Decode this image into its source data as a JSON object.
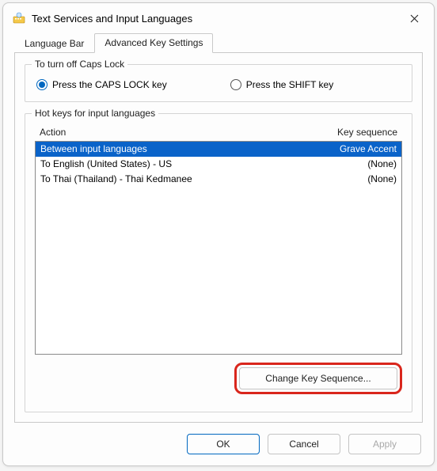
{
  "window": {
    "title": "Text Services and Input Languages"
  },
  "tabs": {
    "language_bar": "Language Bar",
    "advanced_key": "Advanced Key Settings"
  },
  "capslock": {
    "legend": "To turn off Caps Lock",
    "opt_capslock": "Press the CAPS LOCK key",
    "opt_shift": "Press the SHIFT key"
  },
  "hotkeys": {
    "legend": "Hot keys for input languages",
    "col_action": "Action",
    "col_seq": "Key sequence",
    "rows": [
      {
        "action": "Between input languages",
        "seq": "Grave Accent",
        "selected": true
      },
      {
        "action": "To English (United States) - US",
        "seq": "(None)",
        "selected": false
      },
      {
        "action": "To Thai (Thailand) - Thai Kedmanee",
        "seq": "(None)",
        "selected": false
      }
    ],
    "change_btn": "Change Key Sequence..."
  },
  "buttons": {
    "ok": "OK",
    "cancel": "Cancel",
    "apply": "Apply"
  }
}
